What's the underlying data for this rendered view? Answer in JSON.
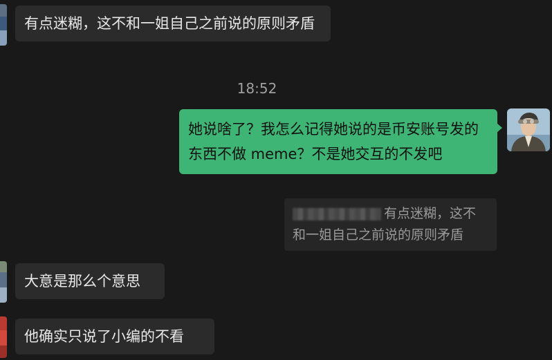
{
  "messages": [
    {
      "side": "incoming",
      "text": "有点迷糊，这不和一姐自己之前说的原则矛盾",
      "avatar_colors": [
        "#6a7a8c",
        "#3d5a7a",
        "#8aa1bb"
      ]
    },
    {
      "side": "outgoing",
      "text": "她说啥了？我怎么记得她说的是币安账号发的东西不做 meme？不是她交互的不发吧"
    },
    {
      "side": "incoming",
      "text": "大意是那么个意思",
      "avatar_colors": [
        "#7b8a74",
        "#5b6f88",
        "#9eb0c4"
      ]
    },
    {
      "side": "incoming",
      "text": "他确实只说了小编的不看",
      "avatar_colors": [
        "#b93a32",
        "#d24a3d",
        "#7a2a25"
      ]
    }
  ],
  "timestamp": "18:52",
  "quote": {
    "text": "有点迷糊，这不和一姐自己之前说的原则矛盾"
  },
  "colors": {
    "background": "#191919",
    "incoming_bubble": "#2b2b2b",
    "outgoing_bubble": "#3eb575",
    "quote_background": "#262626",
    "timestamp_text": "#a0a0a0"
  }
}
